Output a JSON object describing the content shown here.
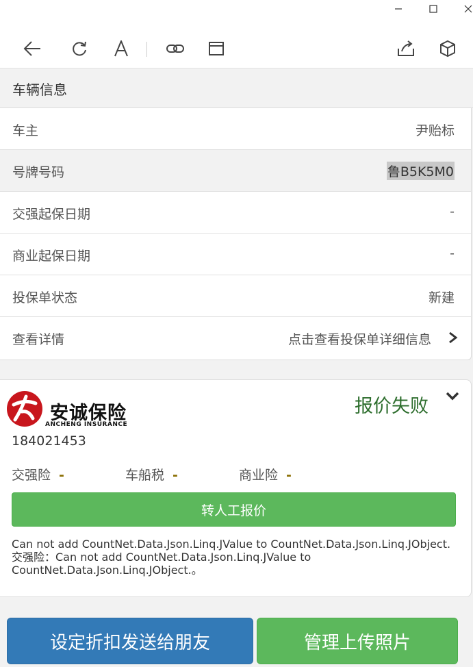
{
  "window": {
    "minimize_icon": "minimize-icon",
    "maximize_icon": "maximize-icon",
    "close_icon": "close-icon"
  },
  "toolbar": {
    "icons": [
      "back-arrow-icon",
      "refresh-icon",
      "font-icon",
      "link-icon",
      "window-icon",
      "share-icon",
      "cube-icon"
    ]
  },
  "vehicle": {
    "section_title": "车辆信息",
    "rows": [
      {
        "label": "车主",
        "value": "尹贻标"
      },
      {
        "label": "号牌号码",
        "value": "鲁B5K5M0"
      },
      {
        "label": "交强起保日期",
        "value": "-"
      },
      {
        "label": "商业起保日期",
        "value": "-"
      },
      {
        "label": "投保单状态",
        "value": "新建"
      },
      {
        "label": "查看详情",
        "value": "点击查看投保单详细信息"
      }
    ]
  },
  "quote": {
    "company_name": "安诚保险",
    "company_name_en": "ANCHENG INSURANCE",
    "status": "报价失败",
    "policy_no": "184021453",
    "coverages": [
      {
        "label": "交强险",
        "value": "-"
      },
      {
        "label": "车船税",
        "value": "-"
      },
      {
        "label": "商业险",
        "value": "-"
      }
    ],
    "manual_quote_label": "转人工报价",
    "error_message": "Can not add CountNet.Data.Json.Linq.JValue to CountNet.Data.Json.Linq.JObject.交强险：Can not add CountNet.Data.Json.Linq.JValue to CountNet.Data.Json.Linq.JObject.。"
  },
  "actions": {
    "discount_label": "设定折扣发送给朋友",
    "photos_label": "管理上传照片"
  },
  "colors": {
    "green": "#5cb85c",
    "blue": "#337ab7",
    "status_green": "#2e6e2e",
    "logo_red": "#c8161d"
  }
}
